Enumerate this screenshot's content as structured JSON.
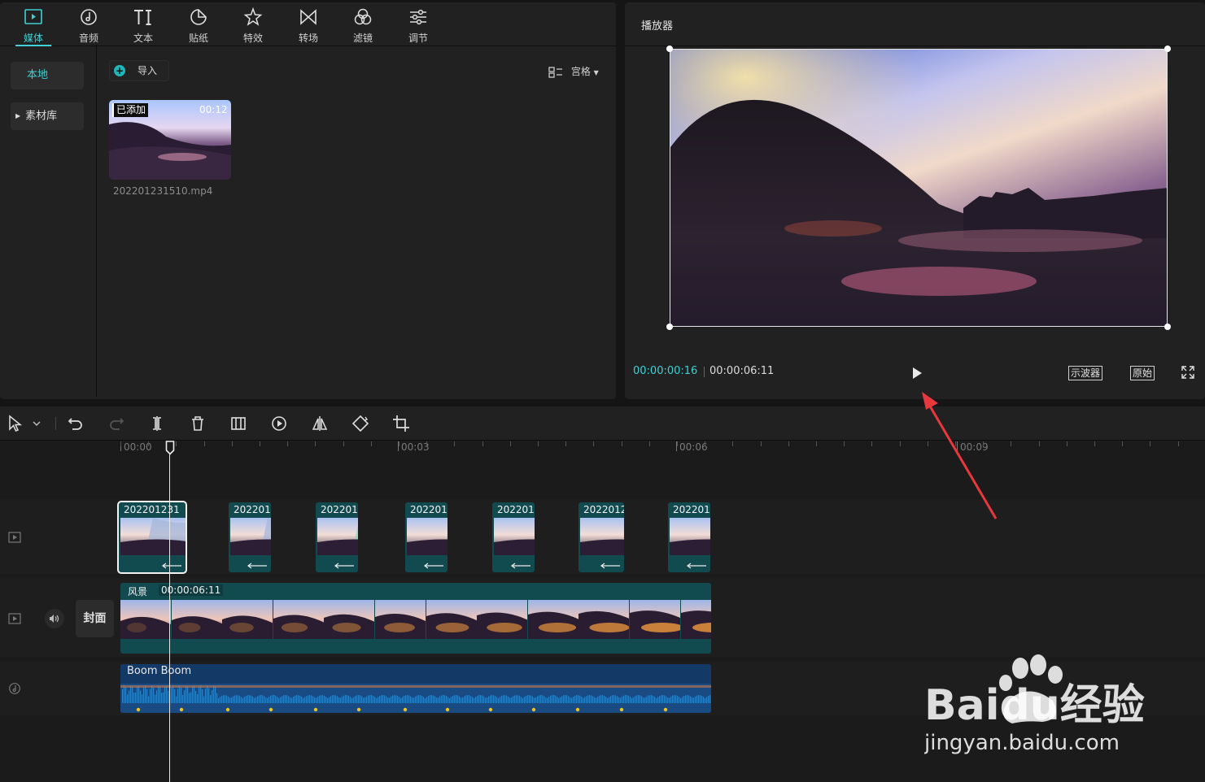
{
  "media_tabs": [
    {
      "label": "媒体",
      "icon": "media-icon",
      "active": true
    },
    {
      "label": "音频",
      "icon": "audio-icon"
    },
    {
      "label": "文本",
      "icon": "text-icon"
    },
    {
      "label": "贴纸",
      "icon": "sticker-icon"
    },
    {
      "label": "特效",
      "icon": "effects-icon"
    },
    {
      "label": "转场",
      "icon": "transition-icon"
    },
    {
      "label": "滤镜",
      "icon": "filter-icon"
    },
    {
      "label": "调节",
      "icon": "adjust-icon"
    }
  ],
  "sidebar": {
    "local": "本地",
    "library": "素材库"
  },
  "media": {
    "import_label": "导入",
    "view_label": "宫格",
    "items": [
      {
        "badge": "已添加",
        "duration": "00:12",
        "filename": "202201231510.mp4"
      }
    ]
  },
  "player": {
    "title": "播放器",
    "current_time": "00:00:00:16",
    "total_time": "00:00:06:11",
    "scope_label": "示波器",
    "ratio_label": "原始"
  },
  "timeline": {
    "ruler": [
      "00:00",
      "00:03",
      "00:06",
      "00:09"
    ],
    "split_clips": [
      "202201231",
      "202201",
      "202201",
      "202201",
      "202201",
      "2022012",
      "202201"
    ],
    "cover_label": "封面",
    "main_clip": {
      "name": "风景",
      "duration": "00:00:06:11"
    },
    "audio_clip": {
      "name": "Boom Boom"
    }
  },
  "watermark": {
    "brand": "Baidu经验",
    "url": "jingyan.baidu.com"
  },
  "colors": {
    "accent": "#3fd1d4",
    "video_track": "#114a4f",
    "audio_track": "#133a66",
    "annotation_arrow": "#e8383d"
  }
}
